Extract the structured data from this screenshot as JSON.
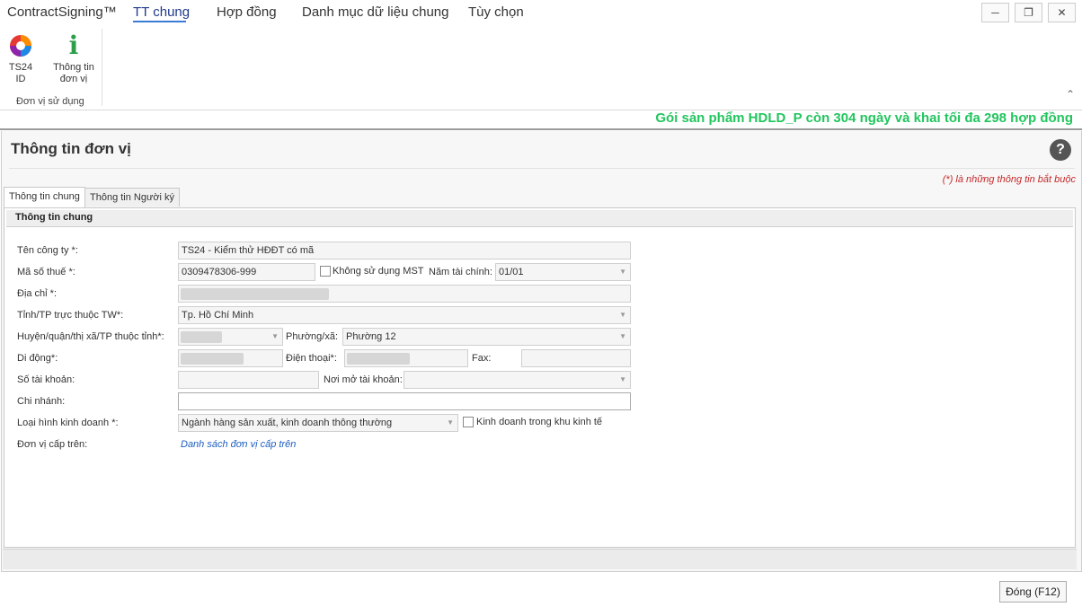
{
  "titlebar": {
    "app_name": "ContractSigning™",
    "menu": [
      "TT chung",
      "Hợp đồng",
      "Danh mục dữ liệu chung",
      "Tùy chọn"
    ],
    "window_buttons": {
      "minimize": "─",
      "restore": "❐",
      "close": "✕"
    }
  },
  "ribbon": {
    "buttons": [
      {
        "label": "TS24 ID",
        "icon": "ts24-logo-icon"
      },
      {
        "label_line1": "Thông tin",
        "label_line2": "đơn vị",
        "icon": "info-icon",
        "glyph": "i"
      }
    ],
    "group_label": "Đơn vị sử dụng",
    "collapse_glyph": "⌃"
  },
  "promo": "Gói sản phẩm HDLD_P còn 304 ngày và khai tối đa 298 hợp đồng",
  "page": {
    "title": "Thông tin đơn vị",
    "help_glyph": "?",
    "required_note": "(*) là những thông tin bắt buộc",
    "tabs": [
      "Thông tin chung",
      "Thông tin Người ký"
    ]
  },
  "form": {
    "group_title": "Thông tin chung",
    "company_name": {
      "label": "Tên công ty *:",
      "value": "TS24 - Kiểm thử HĐĐT có mã"
    },
    "tax_code": {
      "label": "Mã số thuế *:",
      "value": "0309478306-999",
      "no_tax_label": "Không sử dụng MST",
      "fiscal_year_label": "Năm tài chính:",
      "fiscal_year_value": "01/01"
    },
    "address": {
      "label": "Địa chỉ *:"
    },
    "province": {
      "label": "Tỉnh/TP trực thuộc TW*:",
      "value": "Tp. Hồ Chí Minh"
    },
    "district": {
      "label": "Huyện/quận/thị xã/TP thuộc tỉnh*:",
      "ward_label": "Phường/xã:",
      "ward_value": "Phường 12"
    },
    "mobile": {
      "label": "Di động*:",
      "phone_label": "Điện thoại*:",
      "fax_label": "Fax:"
    },
    "bank_account": {
      "label": "Số tài khoản:",
      "bank_label": "Nơi mở tài khoản:"
    },
    "branch": {
      "label": "Chi nhánh:"
    },
    "business_type": {
      "label": "Loại hình kinh doanh *:",
      "value": "Ngành hàng sản xuất, kinh doanh thông thường",
      "econ_zone_label": "Kinh doanh trong khu kinh tế"
    },
    "parent_unit": {
      "label": "Đơn vị cấp trên:",
      "link": "Danh sách đơn vị cấp trên"
    }
  },
  "footer": {
    "close_label": "Đóng (F12)"
  },
  "colors": {
    "promo": "#22c55e",
    "active_tab_underline": "#3a7bd5",
    "required": "#c62828",
    "link": "#1e5fbf"
  }
}
